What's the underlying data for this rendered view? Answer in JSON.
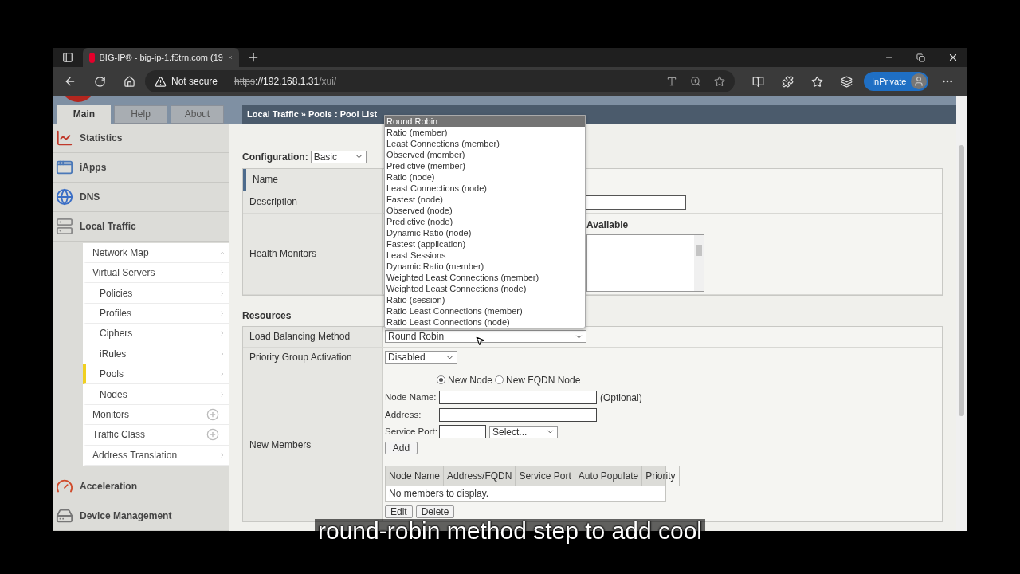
{
  "browser": {
    "tab_title": "BIG-IP® - big-ip-1.f5trn.com (19",
    "security": "Not secure",
    "url": {
      "scheme": "https",
      "host": "://192.168.1.31",
      "path": "/xui/"
    },
    "profile_badge": "InPrivate"
  },
  "top_tabs": [
    {
      "label": "Main",
      "selected": true
    },
    {
      "label": "Help",
      "selected": false
    },
    {
      "label": "About",
      "selected": false
    }
  ],
  "breadcrumb": "Local Traffic » Pools : Pool List",
  "sidebar": {
    "sections_top": [
      {
        "label": "Statistics",
        "kind": "statistics"
      },
      {
        "label": "iApps",
        "kind": "iapps"
      },
      {
        "label": "DNS",
        "kind": "dns"
      },
      {
        "label": "Local Traffic",
        "kind": "traffic"
      }
    ],
    "submenu": [
      {
        "label": "Network Map",
        "kind": "map",
        "selected": false
      },
      {
        "label": "Virtual Servers",
        "kind": "arrow",
        "selected": false,
        "children": [
          {
            "label": "Policies",
            "kind": "arrow",
            "selected": false
          },
          {
            "label": "Profiles",
            "kind": "arrow",
            "selected": false
          },
          {
            "label": "Ciphers",
            "kind": "arrow",
            "selected": false
          },
          {
            "label": "iRules",
            "kind": "arrow",
            "selected": false
          },
          {
            "label": "Pools",
            "kind": "arrow",
            "selected": true
          },
          {
            "label": "Nodes",
            "kind": "arrow",
            "selected": false
          }
        ]
      },
      {
        "label": "Monitors",
        "kind": "plus",
        "selected": false
      },
      {
        "label": "Traffic Class",
        "kind": "plus",
        "selected": false
      },
      {
        "label": "Address Translation",
        "kind": "arrow",
        "selected": false
      }
    ],
    "sections_bottom": [
      {
        "label": "Acceleration",
        "kind": "acceleration"
      },
      {
        "label": "Device Management",
        "kind": "device"
      }
    ]
  },
  "form": {
    "configuration": {
      "label": "Configuration:",
      "value": "Basic"
    },
    "general_rows": [
      {
        "label": "Name",
        "kind": "name"
      },
      {
        "label": "Description",
        "kind": "text"
      },
      {
        "label": "Health Monitors",
        "kind": "monitors"
      }
    ],
    "available_label": "Available",
    "resources_heading": "Resources",
    "load_balancing": {
      "label": "Load Balancing Method",
      "value": "Round Robin",
      "options": [
        {
          "label": "Round Robin",
          "selected": true
        },
        {
          "label": "Ratio (member)",
          "selected": false
        },
        {
          "label": "Least Connections (member)",
          "selected": false
        },
        {
          "label": "Observed (member)",
          "selected": false
        },
        {
          "label": "Predictive (member)",
          "selected": false
        },
        {
          "label": "Ratio (node)",
          "selected": false
        },
        {
          "label": "Least Connections (node)",
          "selected": false
        },
        {
          "label": "Fastest (node)",
          "selected": false
        },
        {
          "label": "Observed (node)",
          "selected": false
        },
        {
          "label": "Predictive (node)",
          "selected": false
        },
        {
          "label": "Dynamic Ratio (node)",
          "selected": false
        },
        {
          "label": "Fastest (application)",
          "selected": false
        },
        {
          "label": "Least Sessions",
          "selected": false
        },
        {
          "label": "Dynamic Ratio (member)",
          "selected": false
        },
        {
          "label": "Weighted Least Connections (member)",
          "selected": false
        },
        {
          "label": "Weighted Least Connections (node)",
          "selected": false
        },
        {
          "label": "Ratio (session)",
          "selected": false
        },
        {
          "label": "Ratio Least Connections (member)",
          "selected": false
        },
        {
          "label": "Ratio Least Connections (node)",
          "selected": false
        }
      ]
    },
    "priority_group": {
      "label": "Priority Group Activation",
      "value": "Disabled"
    },
    "new_members": {
      "label": "New Members",
      "radios": [
        {
          "label": "New Node",
          "selected": true
        },
        {
          "label": "New FQDN Node",
          "selected": false
        }
      ],
      "node_name_label": "Node Name:",
      "optional_note": "(Optional)",
      "address_label": "Address:",
      "service_port_label": "Service Port:",
      "service_select": "Select...",
      "add_button": "Add",
      "table": {
        "columns": [
          "Node Name",
          "Address/FQDN",
          "Service Port",
          "Auto Populate",
          "Priority"
        ],
        "empty_text": "No members to display."
      },
      "buttons": [
        "Edit",
        "Delete"
      ]
    }
  },
  "caption": "round-robin method step to add cool"
}
